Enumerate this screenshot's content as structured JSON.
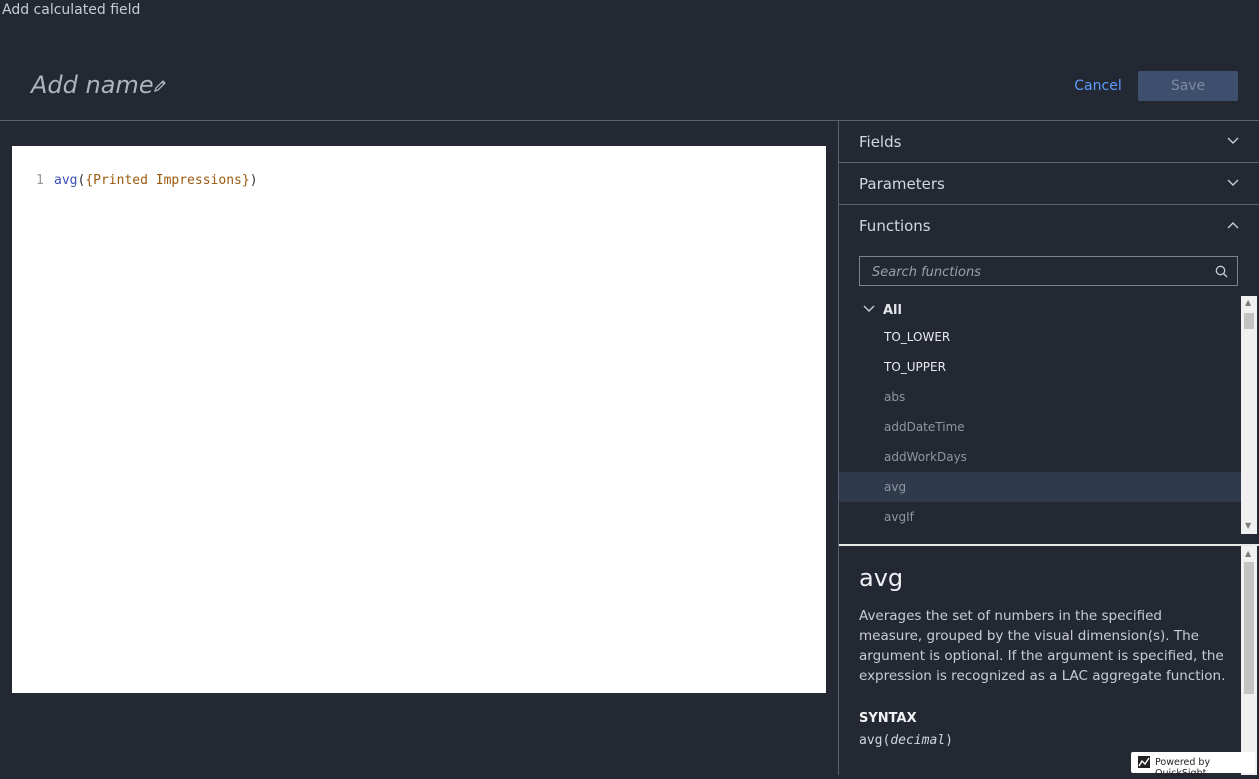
{
  "window": {
    "title": "Add calculated field"
  },
  "header": {
    "name_placeholder": "Add name",
    "cancel_label": "Cancel",
    "save_label": "Save"
  },
  "editor": {
    "line_number": "1",
    "code": {
      "fn": "avg",
      "open": "(",
      "field": "{Printed Impressions}",
      "close": ")"
    }
  },
  "panel": {
    "sections": {
      "fields": "Fields",
      "parameters": "Parameters",
      "functions": "Functions"
    },
    "search": {
      "placeholder": "Search functions"
    },
    "group_label": "All",
    "functions": [
      {
        "name": "TO_LOWER",
        "style": "bright"
      },
      {
        "name": "TO_UPPER",
        "style": "bright"
      },
      {
        "name": "abs",
        "style": "dim"
      },
      {
        "name": "addDateTime",
        "style": "dim"
      },
      {
        "name": "addWorkDays",
        "style": "dim"
      },
      {
        "name": "avg",
        "style": "dim",
        "selected": true
      },
      {
        "name": "avgIf",
        "style": "dim"
      }
    ],
    "detail": {
      "title": "avg",
      "description": "Averages the set of numbers in the specified measure, grouped by the visual dimension(s). The argument is optional. If the argument is specified, the expression is recognized as a LAC aggregate function.",
      "syntax_heading": "SYNTAX",
      "syntax_fn": "avg(",
      "syntax_arg": "decimal",
      "syntax_close": ")"
    }
  },
  "footer": {
    "powered_by": "Powered by QuickSight"
  },
  "colors": {
    "background": "#232832",
    "accent_link": "#5c9cff",
    "save_disabled": "#3e4f6d",
    "selected_row": "#2f3a4d"
  }
}
